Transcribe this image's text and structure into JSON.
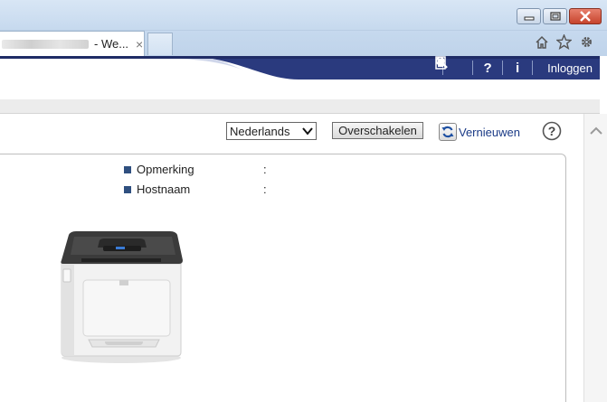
{
  "browser": {
    "tab_title": "- We...",
    "tab_close": "×",
    "window_buttons": [
      "minimize-icon",
      "restore-icon",
      "close-icon"
    ],
    "toolbar_icons": [
      "home-icon",
      "star-icon",
      "gear-icon"
    ]
  },
  "header": {
    "tools": [
      "search-icon",
      "help-icon",
      "info-icon",
      "login-icon"
    ],
    "help_text": "?",
    "info_text": "i",
    "login_label": "Inloggen"
  },
  "toolbar": {
    "language": {
      "selected": "Nederlands",
      "options": [
        "Nederlands"
      ]
    },
    "switch_label": "Overschakelen",
    "refresh_label": "Vernieuwen",
    "help_text": "?"
  },
  "device_info": [
    {
      "label": "Opmerking",
      "separator": ":",
      "value": ""
    },
    {
      "label": "Hostnaam",
      "separator": ":",
      "value": ""
    }
  ],
  "colors": {
    "banner": "#2a3a7e",
    "accent_text": "#1a3a86",
    "bullet": "#2f4f7f"
  }
}
